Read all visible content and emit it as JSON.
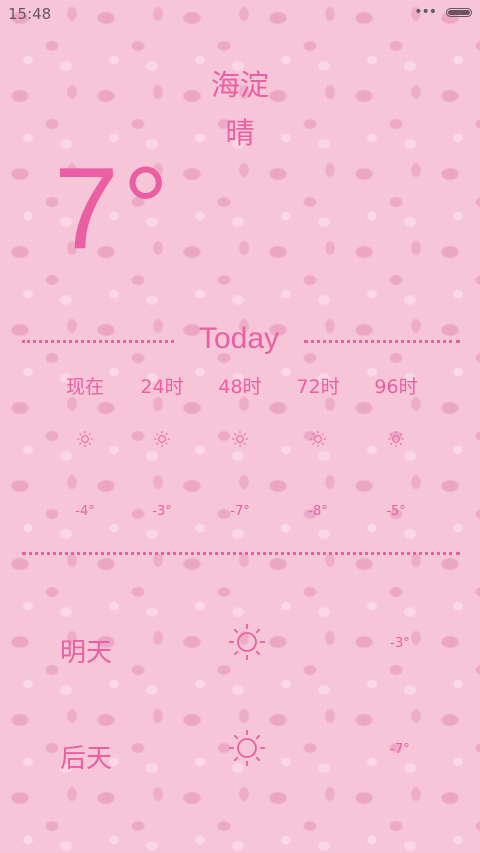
{
  "status_bar": {
    "time": "15:48",
    "dots": "•••"
  },
  "weather": {
    "city": "海淀",
    "condition": "晴",
    "current_temp": "7°",
    "today_label": "Today",
    "hourly": [
      {
        "label": "现在",
        "icon": "sun-icon",
        "temp": "-4°"
      },
      {
        "label": "24时",
        "icon": "sun-icon",
        "temp": "-3°"
      },
      {
        "label": "48时",
        "icon": "sun-icon",
        "temp": "-7°"
      },
      {
        "label": "72时",
        "icon": "sun-icon",
        "temp": "-8°"
      },
      {
        "label": "96时",
        "icon": "sun-icon",
        "temp": "-5°"
      }
    ],
    "daily": [
      {
        "label": "明天",
        "icon": "sun-icon",
        "temp": "-3°"
      },
      {
        "label": "后天",
        "icon": "sun-icon",
        "temp": "-7°"
      }
    ]
  },
  "colors": {
    "accent": "#ea5fa1",
    "background": "#f6c6d8",
    "status_text": "#6a5560"
  }
}
